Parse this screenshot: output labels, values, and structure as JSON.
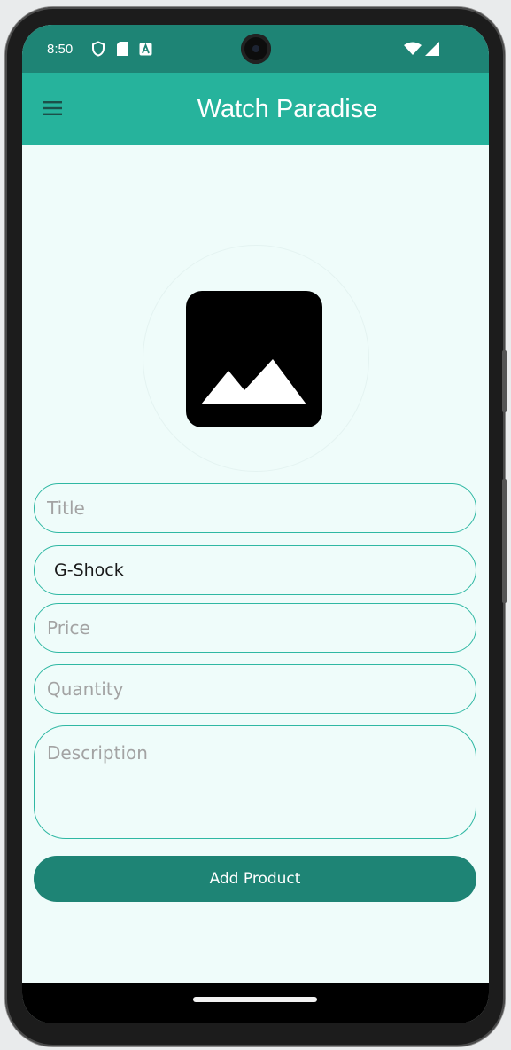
{
  "status_bar": {
    "time": "8:50",
    "left_icons": [
      "shield-icon",
      "sd-card-icon",
      "a-icon"
    ],
    "right_icons": [
      "wifi-icon",
      "cellular-signal-icon"
    ]
  },
  "app_bar": {
    "title": "Watch Paradise",
    "menu_icon": "menu-icon",
    "background_color": "#26b39c"
  },
  "image_picker": {
    "icon": "image-placeholder-icon"
  },
  "form": {
    "title_placeholder": "Title",
    "brand_value": "G-Shock",
    "price_placeholder": "Price",
    "quantity_placeholder": "Quantity",
    "description_placeholder": "Description",
    "submit_label": "Add Product",
    "accent_color": "#2fb8a3",
    "button_color": "#1e8475"
  },
  "colors": {
    "status_bar": "#1e8475",
    "screen_background": "#effcfa"
  }
}
